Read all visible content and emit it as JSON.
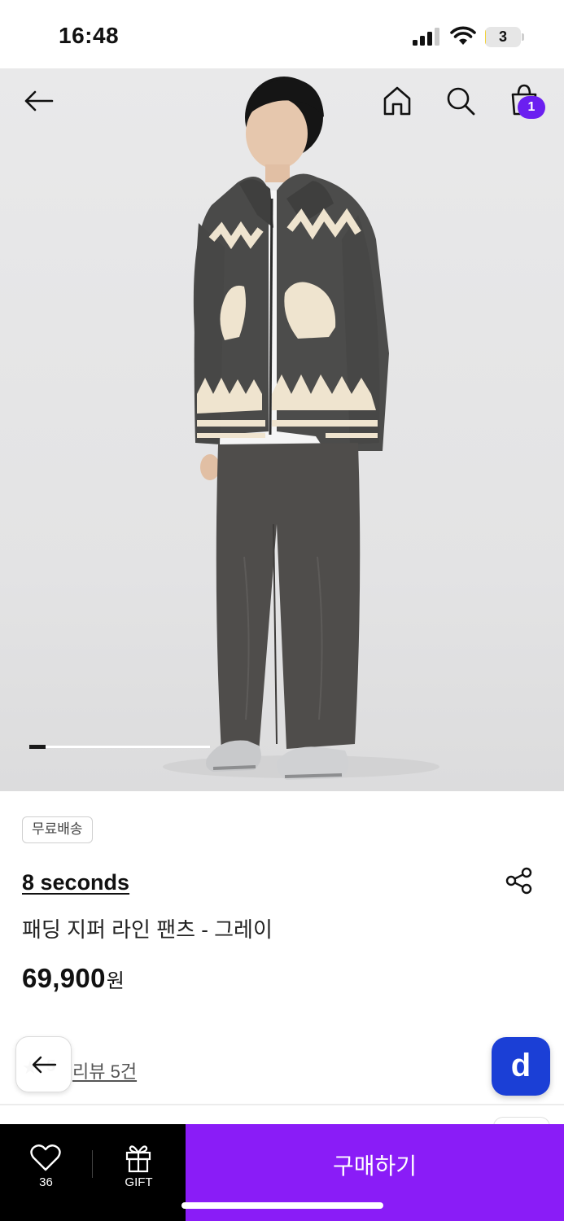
{
  "status_bar": {
    "time": "16:48",
    "battery_level": "3",
    "battery_fraction": 0.03,
    "icons": [
      "cellular-signal-icon",
      "wifi-icon",
      "battery-icon"
    ]
  },
  "header": {
    "icons": [
      "back-arrow-icon",
      "home-icon",
      "search-icon",
      "shopping-bag-icon"
    ],
    "cart_count": "1",
    "accent_color": "#6b1ff0"
  },
  "carousel": {
    "current_index": 1,
    "progress_fraction": 0.09
  },
  "product": {
    "badge": "무료배송",
    "brand": "8 seconds",
    "name": "패딩 지퍼 라인 팬츠 - 그레이",
    "price": "69,900",
    "price_unit": "원",
    "rating": "5",
    "review_link": "리뷰 5건"
  },
  "floating": {
    "app_button_letter": "d",
    "app_button_color": "#1b3fd6"
  },
  "bottom_bar": {
    "like_count": "36",
    "gift_label": "GIFT",
    "buy_label": "구매하기",
    "buy_color": "#8a1cf7"
  }
}
